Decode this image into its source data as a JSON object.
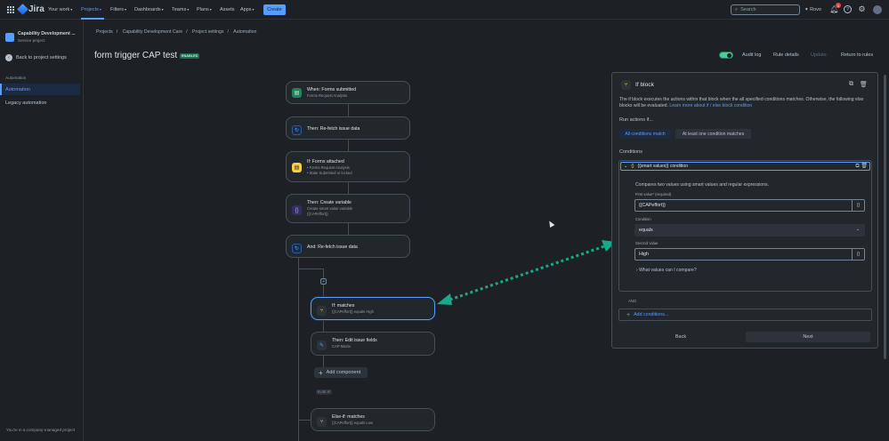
{
  "topbar": {
    "app_name": "Jira",
    "nav": [
      "Your work",
      "Projects",
      "Filters",
      "Dashboards",
      "Teams",
      "Plans",
      "Assets",
      "Apps"
    ],
    "create_label": "Create",
    "search_placeholder": "Search",
    "rovo_label": "Rovo",
    "notification_count": "1"
  },
  "sidebar": {
    "project_name": "Capability Development ...",
    "project_type": "Service project",
    "back_label": "Back to project settings",
    "section_label": "Automation",
    "items": [
      "Automation",
      "Legacy automation"
    ],
    "footer": "You're in a company-managed project"
  },
  "breadcrumb": [
    "Projects",
    "/",
    "Capability Development Care",
    "/",
    "Project settings",
    "/",
    "Automation"
  ],
  "rule": {
    "title": "form trigger CAP test",
    "status": "ENABLED"
  },
  "header_actions": {
    "audit_log": "Audit log",
    "rule_details": "Rule details",
    "update": "Update",
    "return": "Return to rules"
  },
  "flow": {
    "nodes": [
      {
        "title": "When: Forms submitted",
        "sub": "Forms Request Analysis"
      },
      {
        "title": "Then: Re-fetch issue data"
      },
      {
        "title": "If: Forms attached",
        "sub1": "• Forms Request Analysis",
        "sub2": "• State Submitted or locked"
      },
      {
        "title": "Then: Create variable",
        "sub1": "Create smart value variable",
        "sub2": "{{CAPeffort}}"
      },
      {
        "title": "And: Re-fetch issue data"
      },
      {
        "title": "If: matches",
        "sub": "{{CAPeffort}} equals High"
      },
      {
        "title": "Then: Edit issue fields",
        "sub": "CAP Matrix"
      },
      {
        "title": "Else-if: matches",
        "sub": "{{CAPeffort}} equals Low"
      }
    ],
    "add_component": "Add component",
    "else_if_tag": "ELSE IF"
  },
  "panel": {
    "title": "If block",
    "desc": "The if block executes the actions within that block when the all specified conditions matches. Otherwise, the following else blocks will be evaluated.",
    "desc_link": "Learn more about if / else block condition",
    "run_label": "Run actions if...",
    "opt_all": "All conditions match",
    "opt_one": "At least one condition matches",
    "conditions_label": "Conditions",
    "condition_name": "{{smart values}} condition",
    "compare_desc": "Compares two values using smart values and regular expressions.",
    "first_label": "First value* (required)",
    "first_value": "{{CAPeffort}}",
    "condition_label": "Condition",
    "condition_value": "equals",
    "second_label": "Second value",
    "second_value": "High",
    "what_values": "What values can I compare?",
    "and_label": "AND",
    "add_conditions": "Add conditions...",
    "back": "Back",
    "next": "Next"
  },
  "colors": {
    "accent": "#579dff",
    "arrow": "#1aa88a",
    "enabled": "#216e4e"
  }
}
